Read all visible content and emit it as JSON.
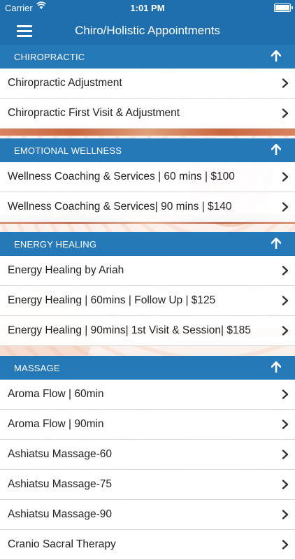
{
  "status": {
    "carrier": "Carrier",
    "time": "1:01 PM"
  },
  "header": {
    "title": "Chiro/Holistic Appointments"
  },
  "sections": [
    {
      "title": "CHIROPRACTIC",
      "items": [
        "Chiropractic Adjustment",
        "Chiropractic First Visit & Adjustment"
      ]
    },
    {
      "title": "EMOTIONAL WELLNESS",
      "items": [
        "Wellness Coaching & Services | 60 mins | $100",
        "Wellness Coaching & Services| 90 mins | $140"
      ]
    },
    {
      "title": "ENERGY HEALING",
      "items": [
        "Energy Healing by Ariah",
        "Energy Healing | 60mins | Follow Up | $125",
        "Energy Healing | 90mins| 1st Visit & Session| $185"
      ]
    },
    {
      "title": "MASSAGE",
      "items": [
        "Aroma Flow | 60min",
        "Aroma Flow | 90min",
        "Ashiatsu Massage-60",
        "Ashiatsu Massage-75",
        "Ashiatsu Massage-90",
        "Cranio Sacral Therapy"
      ]
    }
  ],
  "colors": {
    "nav": "#1f6fae",
    "section": "#2579b9"
  }
}
